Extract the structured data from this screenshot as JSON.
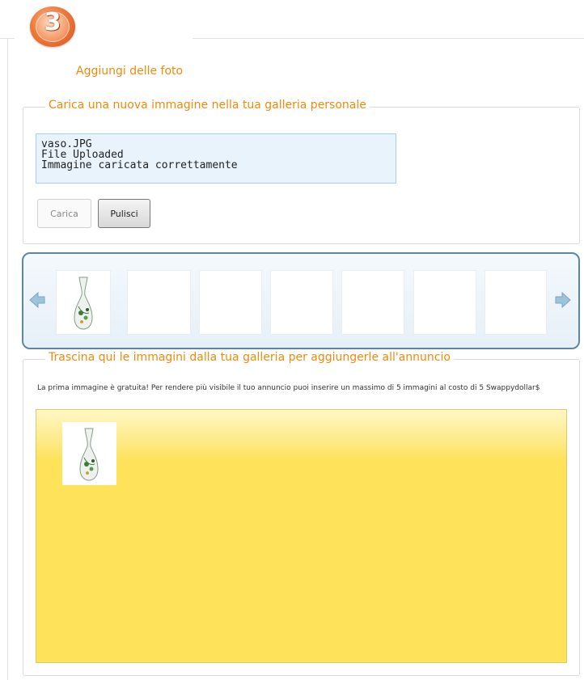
{
  "step": {
    "number": "3",
    "title": "Aggiungi delle foto"
  },
  "upload": {
    "legend": "Carica una nuova immagine nella tua galleria personale",
    "status_lines": [
      "vaso.JPG",
      "File Uploaded",
      "Immagine caricata correttamente"
    ],
    "upload_button_label": "Carica",
    "clear_button_label": "Pulisci"
  },
  "gallery": {
    "thumbnails": [
      {
        "image": "vase-photo"
      },
      {
        "image": ""
      },
      {
        "image": ""
      },
      {
        "image": ""
      },
      {
        "image": ""
      },
      {
        "image": ""
      },
      {
        "image": ""
      }
    ],
    "prev_icon": "arrow-left-icon",
    "next_icon": "arrow-right-icon"
  },
  "ad_images": {
    "legend": "Trascina qui le immagini dalla tua galleria per aggiungerle all'annuncio",
    "note": "La prima immagine è gratuita! Per rendere più visibile il tuo annuncio puoi inserire un massimo di 5 immagini al costo di 5 Swappydollar$",
    "dropped": [
      {
        "image": "vase-photo"
      }
    ]
  },
  "colors": {
    "accent": "#f08a0c",
    "carousel_border": "#5c86a5",
    "dropzone": "#fde25a",
    "status_bg": "#e8f3fc"
  }
}
